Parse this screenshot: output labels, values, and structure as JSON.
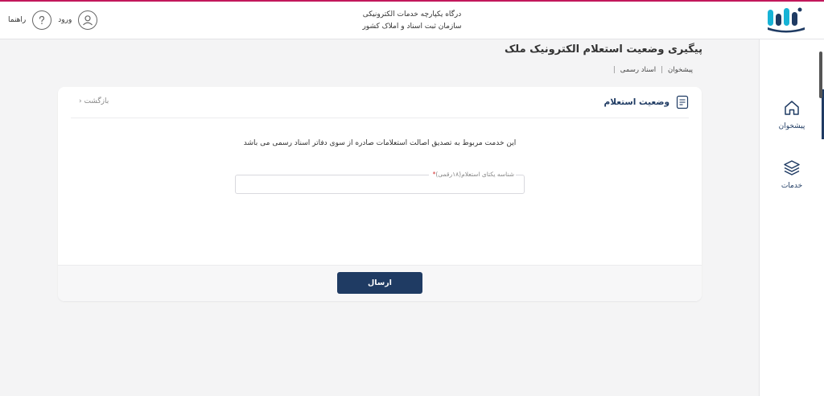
{
  "header": {
    "title_line1": "درگاه یکپارچه خدمات الکترونیکی",
    "title_line2": "سازمان ثبت اسناد و املاک کشور",
    "help_label": "راهنما",
    "help_icon": "question-icon",
    "login_label": "ورود",
    "login_icon": "user-icon"
  },
  "sidebar": {
    "items": [
      {
        "label": "پیشخوان",
        "icon": "home-icon",
        "active": true
      },
      {
        "label": "خدمات",
        "icon": "layers-icon",
        "active": false
      }
    ]
  },
  "page": {
    "title": "پیگیری وضعیت استعلام الکترونیک ملک",
    "breadcrumb": [
      "پیشخوان",
      "اسناد رسمی"
    ]
  },
  "card": {
    "title": "وضعیت استعلام",
    "title_icon": "document-icon",
    "back_label": "بازگشت",
    "description": "این خدمت مربوط به تصدیق اصالت استعلامات صادره از سوی دفاتر اسناد رسمی می باشد",
    "field": {
      "label": "شناسه یکتای استعلام(۱۸رقمی)",
      "required_mark": "*",
      "value": ""
    },
    "submit_label": "ارسال"
  },
  "colors": {
    "brand": "#1f3b63",
    "accent_line": "#c2185b",
    "logo_cyan": "#17b3d6",
    "background": "#f4f4f5"
  }
}
